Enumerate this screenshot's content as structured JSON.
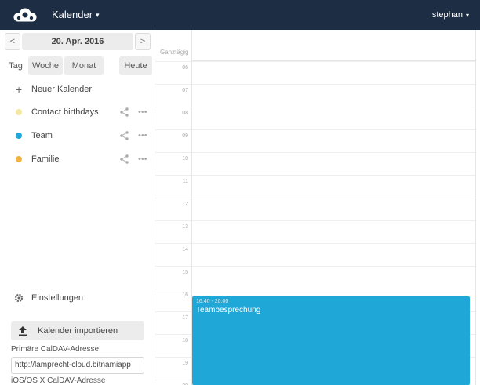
{
  "header": {
    "app_name": "Kalender",
    "user_name": "stephan",
    "caret": "▾",
    "bg_color": "#1d2d44"
  },
  "sidebar": {
    "prev_label": "<",
    "next_label": ">",
    "current_date": "20. Apr. 2016",
    "views": {
      "day": "Tag",
      "week": "Woche",
      "month": "Monat",
      "today": "Heute"
    },
    "new_calendar_label": "Neuer Kalender",
    "calendars": [
      {
        "name": "Contact birthdays",
        "color": "#f3e8a0"
      },
      {
        "name": "Team",
        "color": "#1fa7d8"
      },
      {
        "name": "Familie",
        "color": "#f0b540"
      }
    ],
    "more_label": "•••",
    "settings_label": "Einstellungen",
    "import_label": "Kalender importieren",
    "caldav_primary_label": "Primäre CalDAV-Adresse",
    "caldav_primary_value": "http://lamprecht-cloud.bitnamiapp",
    "caldav_ios_label": "iOS/OS X CalDAV-Adresse"
  },
  "grid": {
    "allday_label": "Ganztägig",
    "hours": [
      "06",
      "07",
      "08",
      "09",
      "10",
      "11",
      "12",
      "13",
      "14",
      "15",
      "16",
      "17",
      "18",
      "19",
      "20"
    ],
    "event": {
      "time": "16:40 - 20:00",
      "title": "Teambesprechung",
      "color": "#1fa7d8"
    }
  }
}
